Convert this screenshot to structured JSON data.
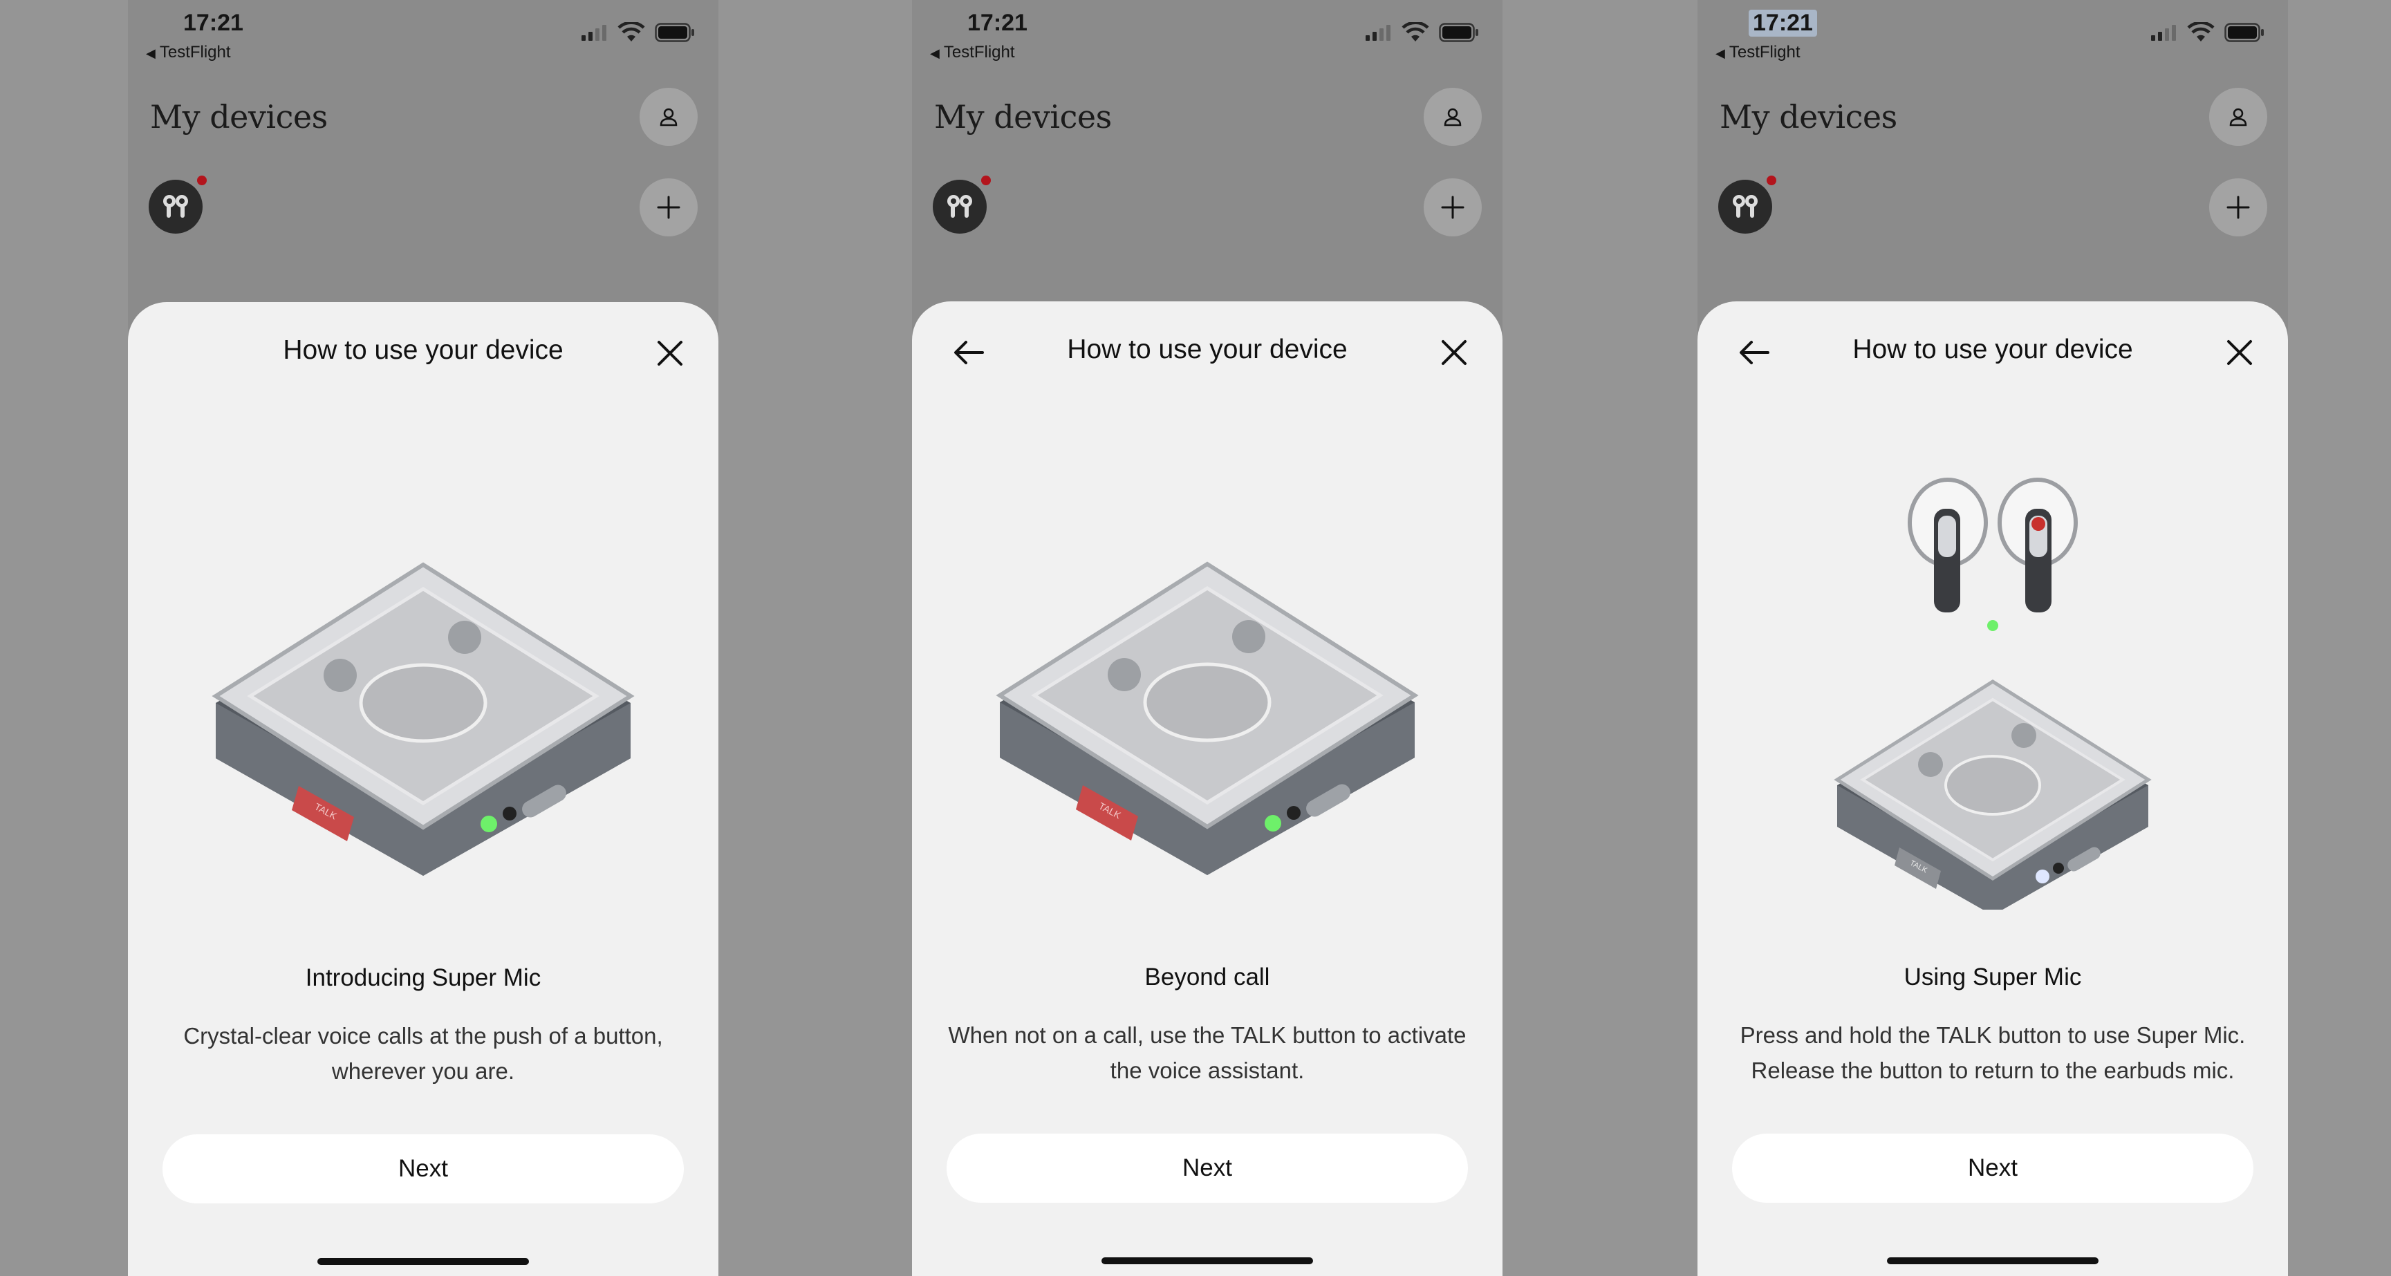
{
  "status_bar": {
    "time": "17:21",
    "back_app": "TestFlight"
  },
  "header": {
    "title": "My devices"
  },
  "sheet": {
    "title": "How to use your device",
    "next_label": "Next"
  },
  "steps": [
    {
      "title": "Introducing Super Mic",
      "desc_line1": "Crystal-clear voice calls at the push of a button,",
      "desc_line2": "wherever you are."
    },
    {
      "title": "Beyond call",
      "desc_line1": "When not on a call, use the TALK button to activate",
      "desc_line2": "the voice assistant."
    },
    {
      "title": "Using Super Mic",
      "desc_line1": "Press and hold the TALK button to use Super Mic.",
      "desc_line2": "Release the button to return to the earbuds mic."
    }
  ],
  "case_label": "TALK",
  "icons": {
    "signal": "cell-signal-icon",
    "wifi": "wifi-icon",
    "battery": "battery-icon",
    "profile": "profile-icon",
    "add": "plus-icon",
    "device": "earbuds-icon",
    "close": "close-icon",
    "back": "arrow-left-icon"
  },
  "colors": {
    "sheet_bg": "#f1f1f1",
    "led_green": "#6ef06a",
    "talk_red": "#c94a4a",
    "notif_red": "#b3141c"
  }
}
